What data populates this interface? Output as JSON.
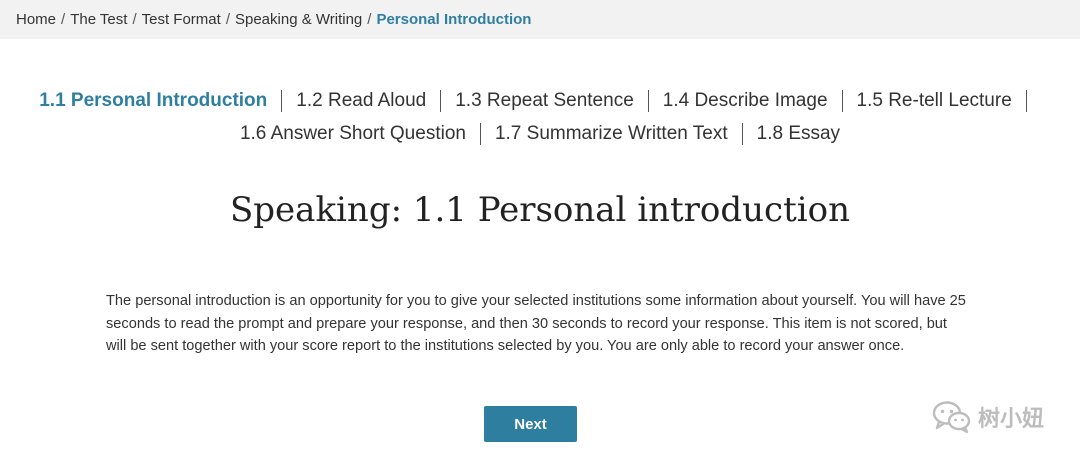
{
  "breadcrumb": {
    "items": [
      "Home",
      "The Test",
      "Test Format",
      "Speaking & Writing"
    ],
    "current": "Personal Introduction",
    "separator": "/"
  },
  "subnav": {
    "row1": [
      "1.1 Personal Introduction",
      "1.2 Read Aloud",
      "1.3 Repeat Sentence",
      "1.4 Describe Image",
      "1.5 Re-tell Lecture"
    ],
    "row2": [
      "1.6 Answer Short Question",
      "1.7 Summarize Written Text",
      "1.8 Essay"
    ],
    "active": "1.1 Personal Introduction"
  },
  "main": {
    "title": "Speaking: 1.1 Personal introduction",
    "description": "The personal introduction is an opportunity for you to give your selected institutions some information about yourself. You will have 25 seconds to read the prompt and prepare your response, and then 30 seconds to record your response. This item is not scored, but will be sent together with your score report to the institutions selected by you. You are only able to record your answer once.",
    "next_label": "Next"
  },
  "watermark": {
    "text": "树小妞",
    "icon": "wechat-icon"
  },
  "colors": {
    "accent": "#2f7fa3",
    "button": "#2e7ea0",
    "breadcrumb_bg": "#f2f2f2"
  }
}
